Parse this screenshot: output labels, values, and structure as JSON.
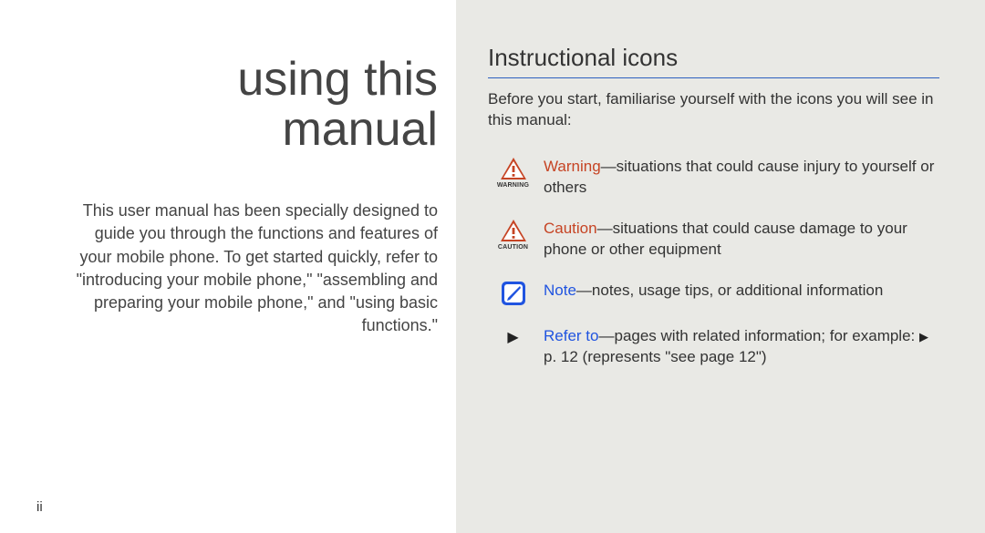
{
  "pageNumber": "ii",
  "leftPage": {
    "titleLine1": "using this",
    "titleLine2": "manual",
    "intro": "This user manual has been specially designed to guide you through the functions and features of your mobile phone. To get started quickly, refer to \"introducing your mobile phone,\" \"assembling and preparing your mobile phone,\" and \"using basic functions.\""
  },
  "rightPage": {
    "heading": "Instructional icons",
    "intro": "Before you start, familiarise yourself with the icons you will see in this manual:",
    "items": [
      {
        "iconLabel": "WARNING",
        "term": "Warning",
        "desc": "—situations that could cause injury to yourself or others"
      },
      {
        "iconLabel": "CAUTION",
        "term": "Caution",
        "desc": "—situations that could cause damage to your phone or other equipment"
      },
      {
        "iconLabel": "",
        "term": "Note",
        "desc": "—notes, usage tips, or additional information"
      },
      {
        "iconLabel": "",
        "term": "Refer to",
        "desc1": "—pages with related information; for example: ",
        "desc2": " p. 12 (represents \"see page 12\")"
      }
    ]
  }
}
